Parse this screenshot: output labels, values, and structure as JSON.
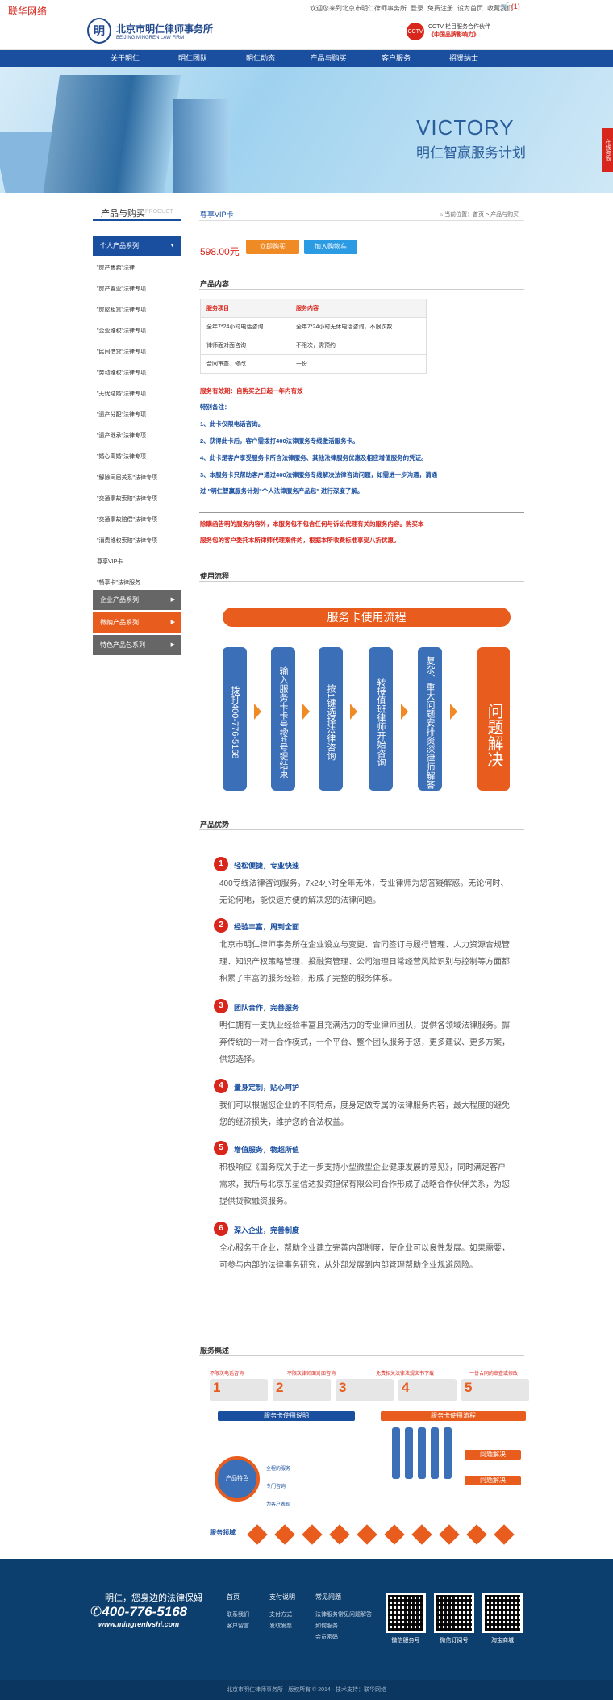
{
  "topbar": {
    "site_name": "联华网络",
    "links": [
      "欢迎您来到北京市明仁律师事务所",
      "登录",
      "免费注册",
      "设为首页",
      "收藏我们"
    ],
    "cart": "(1)"
  },
  "header": {
    "logo_cn": "北京市明仁律师事务所",
    "logo_en": "BEIJING MINGREN LAW FIRM",
    "partner_line1": "CCTV 栏目服务合作伙伴",
    "partner_line2": "《中国品牌影响力》",
    "partner_mark": "CCTV"
  },
  "nav": [
    "关于明仁",
    "明仁团队",
    "明仁动态",
    "产品与购买",
    "客户服务",
    "招贤纳士"
  ],
  "banner": {
    "title": "VICTORY",
    "subtitle": "明仁智赢服务计划",
    "side_tag": "在线咨询"
  },
  "sidebar": {
    "title": "产品与购买",
    "title_en": "PRODUCT",
    "categories": [
      {
        "label": "个人产品系列",
        "color": "#1a4fa0"
      },
      {
        "label": "企业产品系列",
        "color": "#666666"
      },
      {
        "label": "微纳产品系列",
        "color": "#e85c1d"
      },
      {
        "label": "特色产品包系列",
        "color": "#666666"
      }
    ],
    "sub_items": [
      "\"房产售卖\"法律",
      "\"房产置业\"法律专项",
      "\"房屋租赁\"法律专项",
      "\"企业维权\"法律专项",
      "\"民间借贷\"法律专项",
      "\"劳动维权\"法律专项",
      "\"无忧结婚\"法律专项",
      "\"遗产分配\"法律专项",
      "\"遗产继承\"法律专项",
      "\"婚心离婚\"法律专项",
      "\"解除同居关系\"法律专项",
      "\"交通事故索赔\"法律专项",
      "\"交通事故赔偿\"法律专项",
      "\"消费维权索赔\"法律专项",
      "尊享VIP卡",
      "\"畅享卡\"法律服务"
    ]
  },
  "product": {
    "title": "尊享VIP卡",
    "breadcrumb": "当前位置：首页 > 产品与购买",
    "price": "598.00元",
    "buy_button": "立即购买",
    "cart_button": "加入购物车"
  },
  "content": {
    "section_title": "产品内容",
    "table_headers": [
      "服务项目",
      "服务内容"
    ],
    "table_rows": [
      [
        "全年7*24小时电话咨询",
        "全年7*24小时无休电话咨询，不限次数"
      ],
      [
        "律师面对面咨询",
        "不限次，需预约"
      ],
      [
        "合同审查、修改",
        "一份"
      ]
    ],
    "validity": "服务有效期：自购买之日起一年内有效",
    "notes_title": "特别备注：",
    "notes": [
      "1、此卡仅限电话咨询。",
      "2、获得此卡后，客户需拨打400法律服务专线激活服务卡。",
      "4、此卡是客户享受服务卡所含法律服务、其他法律服务优惠及相应增值服务的凭证。",
      "3、本服务卡只帮助客户通过400法律服务专线解决法律咨询问题，如需进一步沟通，请通",
      "过 \"明仁智赢服务计划\"个人法律服务产品包\" 进行深度了解。"
    ],
    "disclaimer": [
      "除購函告明的服务内容外，本服务包不包含任何与诉讼代理有关的服务内容。购买本",
      "服务包的客户委托本所律师代理案件的，根据本所收费标准享受八折优惠。"
    ]
  },
  "flow": {
    "section_title": "使用流程",
    "header": "服务卡使用流程",
    "steps": [
      "拨打400-776-5168",
      "输入服务卡卡号按#号键结束",
      "按1键选择法律咨询",
      "转接值班律师开始咨询",
      "复杂、重大问题安排资深律师解答"
    ],
    "final": "问题解决"
  },
  "advantages": {
    "section_title": "产品优势",
    "items": [
      {
        "num": "1",
        "title": "轻松便捷，专业快速",
        "text": "400专线法律咨询服务。7x24小时全年无休，专业律师为您答疑解惑。无论何时、无论何地，能快速方便的解决您的法律问题。"
      },
      {
        "num": "2",
        "title": "经验丰富，周到全面",
        "text": "北京市明仁律师事务所在企业设立与变更、合同签订与履行管理、人力资源合规管理、知识产权策略管理、投融资管理、公司治理日常经营风险识别与控制等方面都积累了丰富的服务经验，形成了完整的服务体系。"
      },
      {
        "num": "3",
        "title": "团队合作，完善服务",
        "text": "明仁拥有一支执业经验丰富且充满活力的专业律师团队，提供各领域法律服务。摒弃传统的一对一合作模式，一个平台、整个团队服务于您，更多建议、更多方案，供您选择。"
      },
      {
        "num": "4",
        "title": "量身定制，贴心呵护",
        "text": "我们可以根据您企业的不同特点，度身定做专属的法律服务内容，最大程度的避免您的经济损失，维护您的合法权益。"
      },
      {
        "num": "5",
        "title": "增值服务，物超所值",
        "text": "积极响应《国务院关于进一步支持小型微型企业健康发展的意见》，同时满足客户需求，我所与北京东星信达投资担保有限公司合作形成了战略合作伙伴关系，为您提供贷款融资服务。"
      },
      {
        "num": "6",
        "title": "深入企业，完善制度",
        "text": "全心服务于企业，帮助企业建立完善内部制度，使企业可以良性发展。如果需要，可参与内部的法律事务研究，从外部发展到内部管理帮助企业规避风险。"
      }
    ]
  },
  "overview": {
    "section_title": "服务概述",
    "top_tabs": [
      "不限次电话咨询",
      "不限次律师面对面咨询",
      "免费相关法律法规文书下载",
      "一份合同的审查或修改"
    ],
    "step_numbers": [
      "1",
      "2",
      "3",
      "4",
      "5"
    ],
    "left_bar": "服务卡使用说明",
    "right_bar": "服务卡使用流程",
    "circle_label": "产品特色",
    "right_labels": [
      "问题解决",
      "问题解决"
    ],
    "domain_label": "服务领域",
    "item_labels": [
      "全程的服务",
      "专门咨询",
      "为客户表现"
    ]
  },
  "footer": {
    "slogan": "明仁，您身边的法律保姆",
    "phone": "400-776-5168",
    "url": "www.mingrenlvshi.com",
    "columns": [
      {
        "head": "首页",
        "items": [
          "联系我们",
          "客户留言"
        ]
      },
      {
        "head": "支付说明",
        "items": [
          "支付方式",
          "发取发票"
        ]
      },
      {
        "head": "常见问题",
        "items": [
          "法律服务常见问题解答",
          "如何服务",
          "会员密码"
        ]
      }
    ],
    "qr_labels": [
      "微信服务号",
      "微信订阅号",
      "淘宝商城"
    ],
    "copyright": "北京市明仁律师事务所 · 版权所有 © 2014 · 技术支持：联华网络"
  },
  "colors": {
    "brand_blue": "#1a4fa0",
    "accent_orange": "#e85c1d",
    "accent_red": "#d9261c",
    "footer": "#0d3f6e"
  }
}
